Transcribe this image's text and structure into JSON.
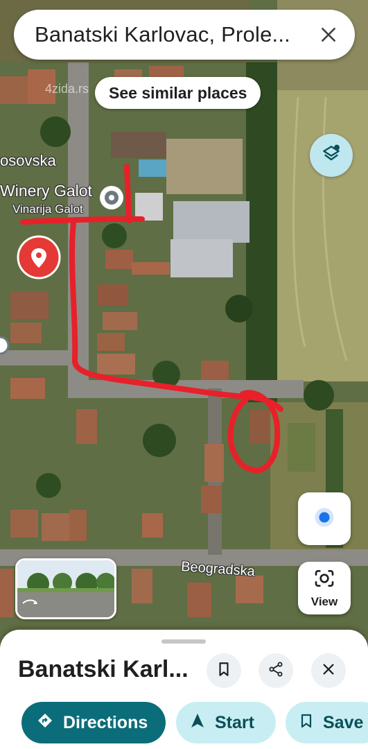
{
  "search": {
    "query": "Banatski Karlovac, Prole..."
  },
  "chip": {
    "label": "See similar places"
  },
  "map": {
    "labels": {
      "street_top": "osovska",
      "winery_en": "Winery Galot",
      "winery_local": "Vinarija Galot",
      "street_bottom": "Beogradska",
      "watermark": "4zida.rs"
    },
    "route_color": "#e8202a"
  },
  "controls": {
    "view_label": "View"
  },
  "sheet": {
    "title": "Banatski Karl...",
    "actions": {
      "directions": "Directions",
      "start": "Start",
      "save": "Save"
    }
  },
  "icons": {
    "close": "close-icon",
    "layers": "layers-icon",
    "my_location": "my-location-icon",
    "camera": "camera-icon",
    "bookmark": "bookmark-icon",
    "share": "share-icon",
    "directions": "directions-icon",
    "navigation": "navigation-arrow-icon"
  },
  "colors": {
    "accent": "#0b6d79",
    "accent_light": "#c8eef3",
    "pin": "#e53935",
    "location_dot": "#1a73e8"
  }
}
